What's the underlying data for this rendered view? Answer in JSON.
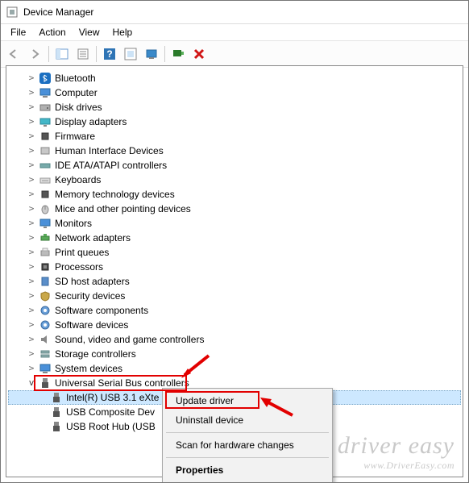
{
  "window": {
    "title": "Device Manager"
  },
  "menu": {
    "items": [
      "File",
      "Action",
      "View",
      "Help"
    ]
  },
  "toolbar_icons": [
    "back",
    "forward",
    "|",
    "show-hide",
    "properties",
    "|",
    "help",
    "update",
    "monitor",
    "|",
    "scan",
    "delete"
  ],
  "tree": {
    "collapsed": [
      {
        "label": "Bluetooth",
        "icon": "bluetooth"
      },
      {
        "label": "Computer",
        "icon": "computer"
      },
      {
        "label": "Disk drives",
        "icon": "disk"
      },
      {
        "label": "Display adapters",
        "icon": "display"
      },
      {
        "label": "Firmware",
        "icon": "chip"
      },
      {
        "label": "Human Interface Devices",
        "icon": "hid"
      },
      {
        "label": "IDE ATA/ATAPI controllers",
        "icon": "ide"
      },
      {
        "label": "Keyboards",
        "icon": "keyboard"
      },
      {
        "label": "Memory technology devices",
        "icon": "chip"
      },
      {
        "label": "Mice and other pointing devices",
        "icon": "mouse"
      },
      {
        "label": "Monitors",
        "icon": "monitor"
      },
      {
        "label": "Network adapters",
        "icon": "network"
      },
      {
        "label": "Print queues",
        "icon": "printer"
      },
      {
        "label": "Processors",
        "icon": "cpu"
      },
      {
        "label": "SD host adapters",
        "icon": "sd"
      },
      {
        "label": "Security devices",
        "icon": "security"
      },
      {
        "label": "Software components",
        "icon": "component"
      },
      {
        "label": "Software devices",
        "icon": "component"
      },
      {
        "label": "Sound, video and game controllers",
        "icon": "sound"
      },
      {
        "label": "Storage controllers",
        "icon": "storage"
      },
      {
        "label": "System devices",
        "icon": "system"
      }
    ],
    "expanded": {
      "label": "Universal Serial Bus controllers",
      "icon": "usb",
      "children": [
        {
          "label": "Intel(R) USB 3.1 eXte",
          "icon": "usbdev",
          "selected": true
        },
        {
          "label": "USB Composite Dev",
          "icon": "usbdev"
        },
        {
          "label": "USB Root Hub (USB",
          "icon": "usbdev"
        }
      ]
    }
  },
  "context_menu": {
    "items": [
      {
        "label": "Update driver"
      },
      {
        "label": "Uninstall device"
      },
      {
        "sep": true
      },
      {
        "label": "Scan for hardware changes"
      },
      {
        "sep": true
      },
      {
        "label": "Properties",
        "bold": true
      }
    ]
  },
  "annotations": {
    "highlight_usb_category": true,
    "highlight_update_driver": true
  },
  "watermark": {
    "line1": "driver easy",
    "line2": "www.DriverEasy.com"
  }
}
